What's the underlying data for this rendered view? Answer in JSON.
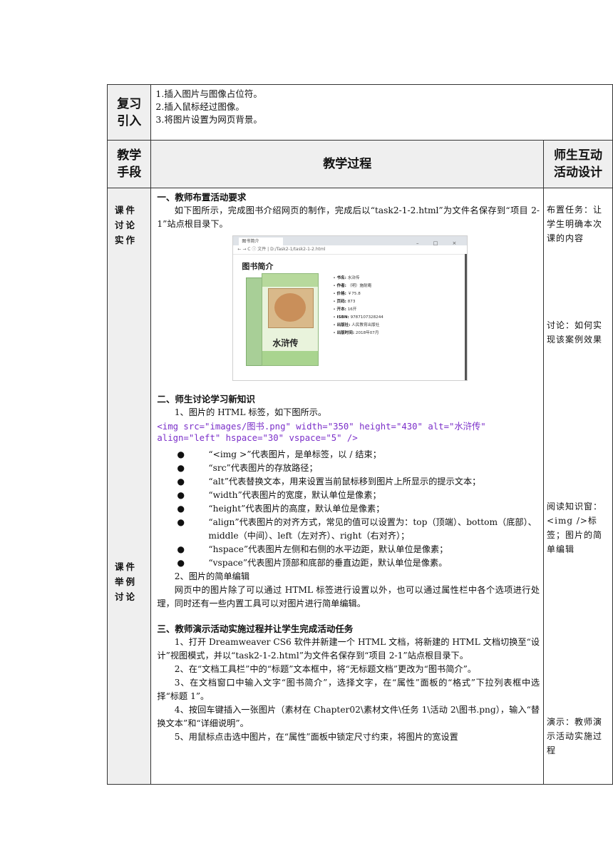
{
  "review": {
    "title_line1": "复习",
    "title_line2": "引入",
    "items": [
      "1.插入图片与图像占位符。",
      "2.插入鼠标经过图像。",
      "3.将图片设置为网页背景。"
    ]
  },
  "header": {
    "method_line1": "教学",
    "method_line2": "手段",
    "process": "教学过程",
    "interaction_line1": "师生互动",
    "interaction_line2": "活动设计"
  },
  "side": {
    "tag1": [
      "课件",
      "讨论",
      "实作"
    ],
    "tag2": [
      "课件",
      "举例",
      "讨论"
    ]
  },
  "sec1": {
    "title": "一、教师布置活动要求",
    "para": "如下图所示，完成图书介绍网页的制作，完成后以“task2-1-2.html”为文件名保存到“项目 2-1”站点根目录下。"
  },
  "screenshot": {
    "tab_label": "图书简介",
    "window_buttons": "–  □  ×",
    "address": "← → C  ⓘ 文件 | D:/Task2-1/task2-1-2.html",
    "page_heading": "图书简介",
    "cover_title": "水浒传",
    "info": [
      {
        "k": "书名:",
        "v": "水浒传"
      },
      {
        "k": "作者:",
        "v": "（明）施耐庵"
      },
      {
        "k": "价格:",
        "v": "￥75.8"
      },
      {
        "k": "页码:",
        "v": "873"
      },
      {
        "k": "开本:",
        "v": "16开"
      },
      {
        "k": "ISBN:",
        "v": "9787107328244"
      },
      {
        "k": "出版社:",
        "v": "人民教育出版社"
      },
      {
        "k": "出版时间:",
        "v": "2018年07月"
      }
    ]
  },
  "sec2": {
    "title": "二、师生讨论学习新知识",
    "p1": "1、图片的 HTML 标签，如下图所示。",
    "code_line1": "<img src=\"images/图书.png\" width=\"350\" height=\"430\" alt=\"水浒传\"",
    "code_line2": " align=\"left\" hspace=\"30\" vspace=\"5\" />",
    "bullets": [
      "“<img >”代表图片，是单标签，以 / 结束；",
      "“src”代表图片的存放路径；",
      "“alt”代表替换文本，用来设置当前鼠标移到图片上所显示的提示文本；",
      "“width”代表图片的宽度，默认单位是像素；",
      "“height”代表图片的高度，默认单位是像素；",
      "“align”代表图片的对齐方式，常见的值可以设置为：top（顶端）、bottom（底部）、middle（中间）、left（左对齐）、right（右对齐）；",
      "“hspace”代表图片左侧和右侧的水平边距，默认单位是像素；",
      "“vspace”代表图片顶部和底部的垂直边距，默认单位是像素。"
    ],
    "p2": "2、图片的简单编辑",
    "p3": "网页中的图片除了可以通过 HTML 标签进行设置以外，也可以通过属性栏中各个选项进行处理，同时还有一些内置工具可以对图片进行简单编辑。"
  },
  "sec3": {
    "title": "三、教师演示活动实施过程并让学生完成活动任务",
    "steps": [
      "1、打开 Dreamweaver CS6 软件并新建一个 HTML 文档，将新建的 HTML 文档切换至“设计”视图模式，并以“task2-1-2.html”为文件名保存到“项目 2-1”站点根目录下。",
      "2、在“文档工具栏”中的“标题”文本框中，将“无标题文档”更改为“图书简介”。",
      "3、在文档窗口中输入文字“图书简介”，选择文字，在“属性”面板的“格式”下拉列表框中选择“标题 1”。",
      "4、按回车键插入一张图片（素材在 Chapter02\\素材文件\\任务 1\\活动 2\\图书.png），输入“替换文本”和“详细说明”。",
      "5、用鼠标点击选中图片，在“属性”面板中锁定尺寸约束，将图片的宽设置"
    ]
  },
  "notes": {
    "n1": "布置任务：让学生明确本次课的内容",
    "n2": "讨论：如何实现该案例效果",
    "n3": "阅读知识窗：<img />标签；图片的简单编辑",
    "n4": "演示：教师演示活动实施过程"
  }
}
